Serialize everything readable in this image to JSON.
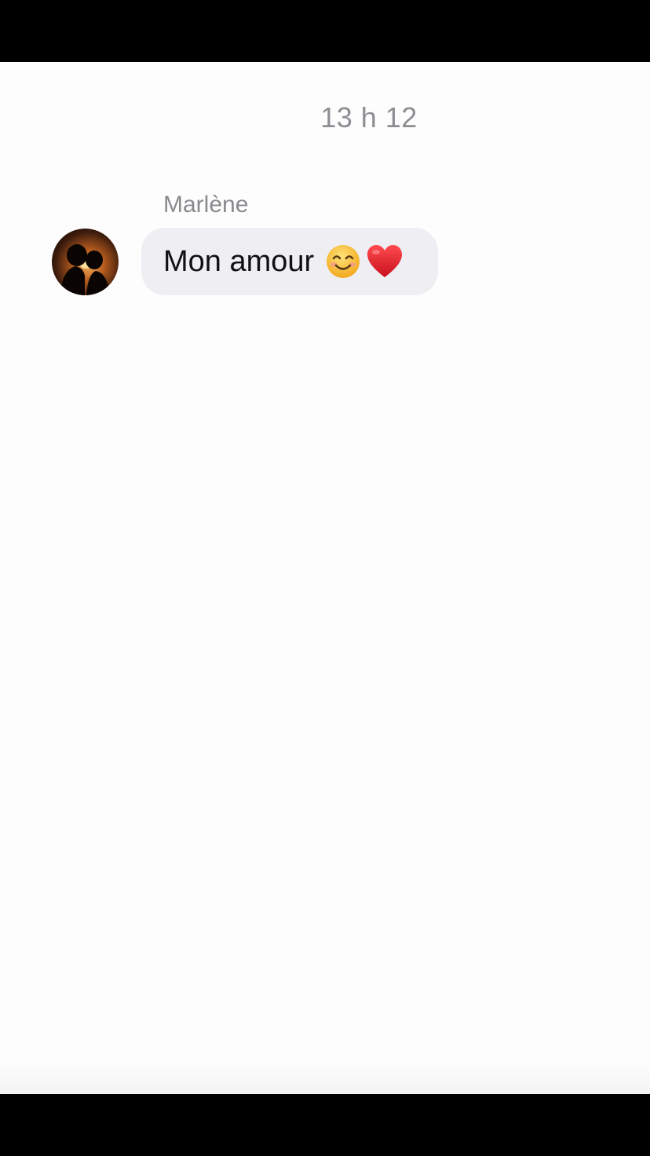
{
  "chat": {
    "timestamp": "13 h 12",
    "messages": [
      {
        "sender": "Marlène",
        "text": "Mon amour",
        "emojis": [
          "smiling-face-emoji",
          "red-heart-emoji"
        ]
      }
    ]
  },
  "colors": {
    "background": "#fefdfe",
    "bubble": "#efeef3",
    "meta_text": "#8e8e93",
    "heart": "#e0242f",
    "smiley": "#f6c534"
  }
}
